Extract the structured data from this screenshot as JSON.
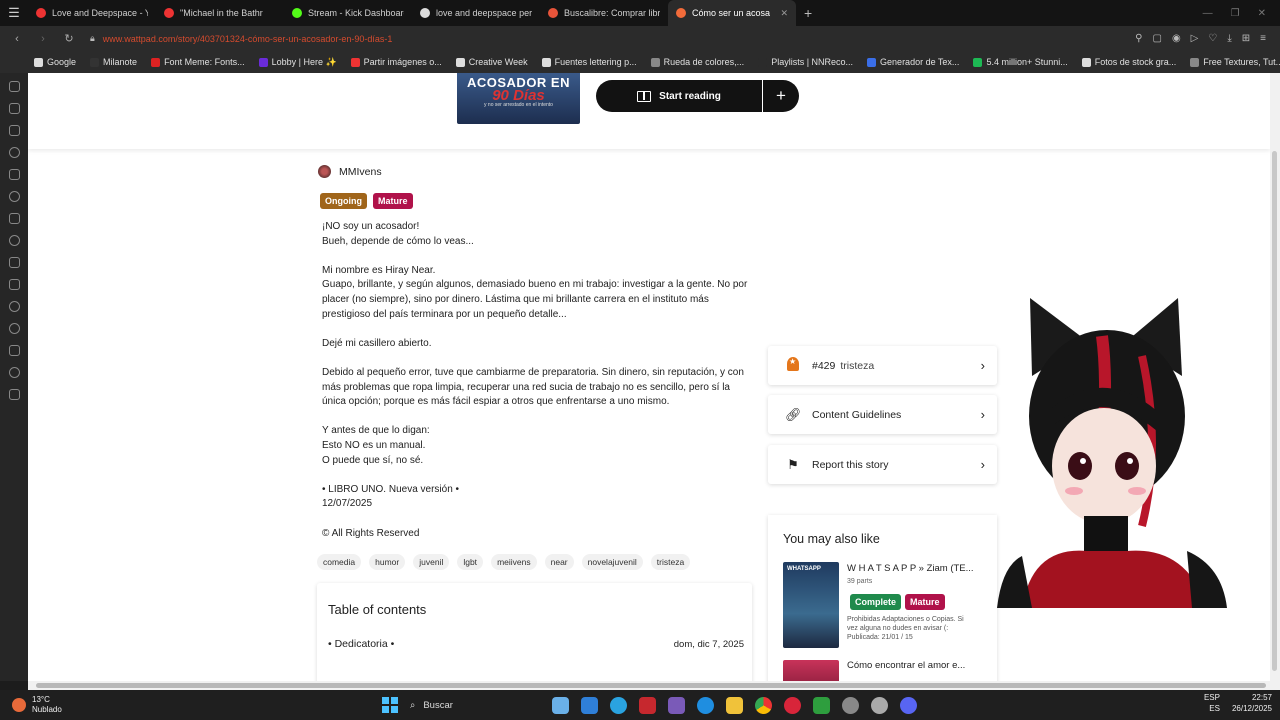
{
  "browser": {
    "tabs": [
      {
        "label": "Love and Deepspace - Yo",
        "color": "#e33"
      },
      {
        "label": "\"Michael in the Bathr",
        "color": "#e33"
      },
      {
        "label": "Stream - Kick Dashboard",
        "color": "#53fc18"
      },
      {
        "label": "love and deepspace pers",
        "color": "#ddd"
      },
      {
        "label": "Buscalibre: Comprar libro",
        "color": "#e8543a"
      },
      {
        "label": "Cómo ser un acosador en",
        "color": "#f26b3a",
        "active": true
      }
    ],
    "url": "www.wattpad.com/story/403701324-cómo-ser-un-acosador-en-90-días-1",
    "bookmarks": [
      {
        "label": "Google",
        "color": "#ddd"
      },
      {
        "label": "Milanote",
        "color": "#333"
      },
      {
        "label": "Font Meme: Fonts...",
        "color": "#d22"
      },
      {
        "label": "Lobby | Here ✨",
        "color": "#6a2bd9"
      },
      {
        "label": "Partir imágenes o...",
        "color": "#e33"
      },
      {
        "label": "Creative Week",
        "color": "#ddd"
      },
      {
        "label": "Fuentes lettering p...",
        "color": "#ddd"
      },
      {
        "label": "Rueda de colores,...",
        "color": "#888"
      },
      {
        "label": "Playlists | NNReco...",
        "color": "#2b2b2b"
      },
      {
        "label": "Generador de Tex...",
        "color": "#3a6ee8"
      },
      {
        "label": "5.4 million+ Stunni...",
        "color": "#1db954"
      },
      {
        "label": "Fotos de stock gra...",
        "color": "#ddd"
      },
      {
        "label": "Free Textures, Tut...",
        "color": "#888"
      }
    ]
  },
  "story": {
    "cover_line1": "ACOSADOR EN",
    "cover_line2": "90 Días",
    "cover_line3": "y no ser arrestado en el intento",
    "start_reading": "Start reading",
    "add_label": "+",
    "author": "MMIvens",
    "badge_ongoing": "Ongoing",
    "badge_mature": "Mature",
    "description": [
      "¡NO soy un acosador!",
      "Bueh, depende de cómo lo veas...",
      "",
      "Mi nombre es Hiray Near.",
      "Guapo, brillante, y según algunos, demasiado bueno en mi trabajo: investigar a la gente. No por placer (no siempre), sino por dinero. Lástima que mi brillante carrera en el instituto más prestigioso del país terminara por un pequeño detalle...",
      "",
      "Dejé mi casillero abierto.",
      "",
      "Debido al pequeño error, tuve que cambiarme de preparatoria. Sin dinero, sin reputación, y con más problemas que ropa limpia, recuperar una red sucia de trabajo no es sencillo, pero sí la única opción; porque es más fácil espiar a otros que enfrentarse a uno mismo.",
      "",
      "Y antes de que lo digan:",
      "Esto NO es un manual.",
      "O puede que sí, no sé.",
      "",
      "• LIBRO UNO. Nueva versión •",
      "12/07/2025"
    ],
    "rights": "© All Rights Reserved",
    "tags": [
      "comedia",
      "humor",
      "juvenil",
      "lgbt",
      "meiivens",
      "near",
      "novelajuvenil",
      "tristeza"
    ],
    "toc_title": "Table of contents",
    "toc_item": "• Dedicatoria •",
    "toc_date": "dom, dic 7, 2025"
  },
  "sidebar": {
    "rank": "#429",
    "rank_tag": "tristeza",
    "guidelines": "Content Guidelines",
    "report": "Report this story",
    "may_also_like": "You may also like",
    "rec1_title": "W H A T S A P P » Ziam (TE...",
    "rec1_parts": "39 parts",
    "rec1_badge_complete": "Complete",
    "rec1_badge_mature": "Mature",
    "rec1_desc": "Prohibidas Adaptaciones o Copias. Si vez alguna no dudes en avisar (: Publicada: 21/01 / 15",
    "rec1_cover_text": "WHATSAPP",
    "rec2_title": "Cómo encontrar el amor e..."
  },
  "taskbar": {
    "temp": "13°C",
    "weather": "Nublado",
    "search": "Buscar",
    "lang1": "ESP",
    "lang2": "ES",
    "time": "22:57",
    "date": "26/12/2025"
  },
  "colors": {
    "ongoing": "#a0651a",
    "mature": "#b0124a",
    "complete": "#1f8a4c",
    "wattpad_orange": "#ff6122"
  }
}
